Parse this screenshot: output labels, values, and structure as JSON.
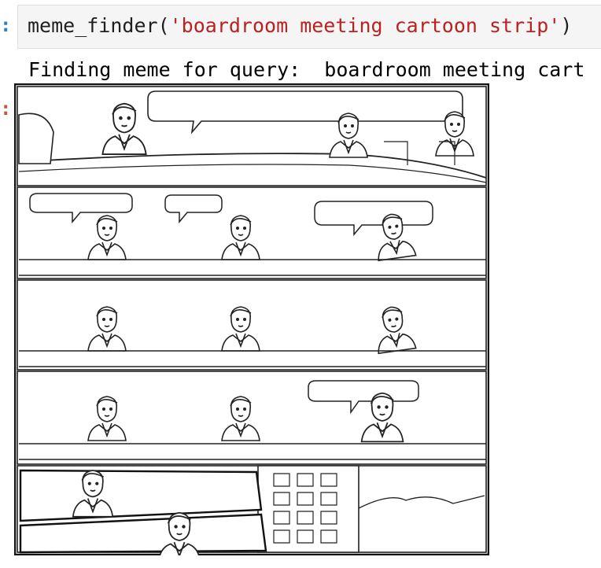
{
  "cell": {
    "input_prompt": ":",
    "output_prompt": ":",
    "code": {
      "func": "meme_finder(",
      "arg": "'boardroom meeting cartoon strip'",
      "close": ")"
    },
    "output_line": "Finding meme for query:  boardroom meeting cart"
  }
}
